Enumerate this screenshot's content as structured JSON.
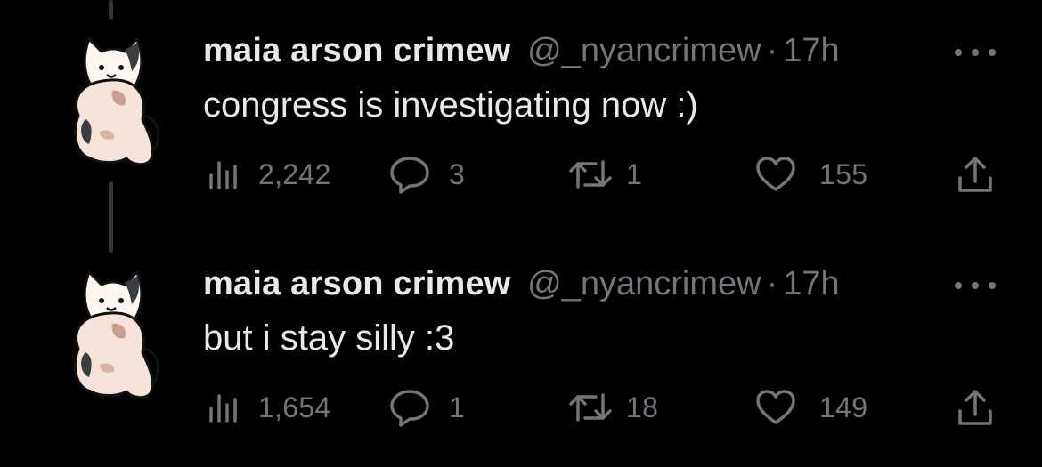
{
  "tweets": [
    {
      "author": {
        "name": "maia arson crimew",
        "handle": "@_nyancrimew"
      },
      "separator": "·",
      "time": "17h",
      "text": "congress is investigating now :)",
      "stats": {
        "views": "2,242",
        "replies": "3",
        "reposts": "1",
        "likes": "155"
      }
    },
    {
      "author": {
        "name": "maia arson crimew",
        "handle": "@_nyancrimew"
      },
      "separator": "·",
      "time": "17h",
      "text": "but i stay silly :3",
      "stats": {
        "views": "1,654",
        "replies": "1",
        "reposts": "18",
        "likes": "149"
      }
    }
  ],
  "colors": {
    "background": "#000000",
    "text": "#e7e9ea",
    "secondary": "#71767b",
    "thread_line": "#333639"
  },
  "icons": [
    "views-icon",
    "reply-icon",
    "repost-icon",
    "like-icon",
    "share-icon",
    "more-icon"
  ]
}
